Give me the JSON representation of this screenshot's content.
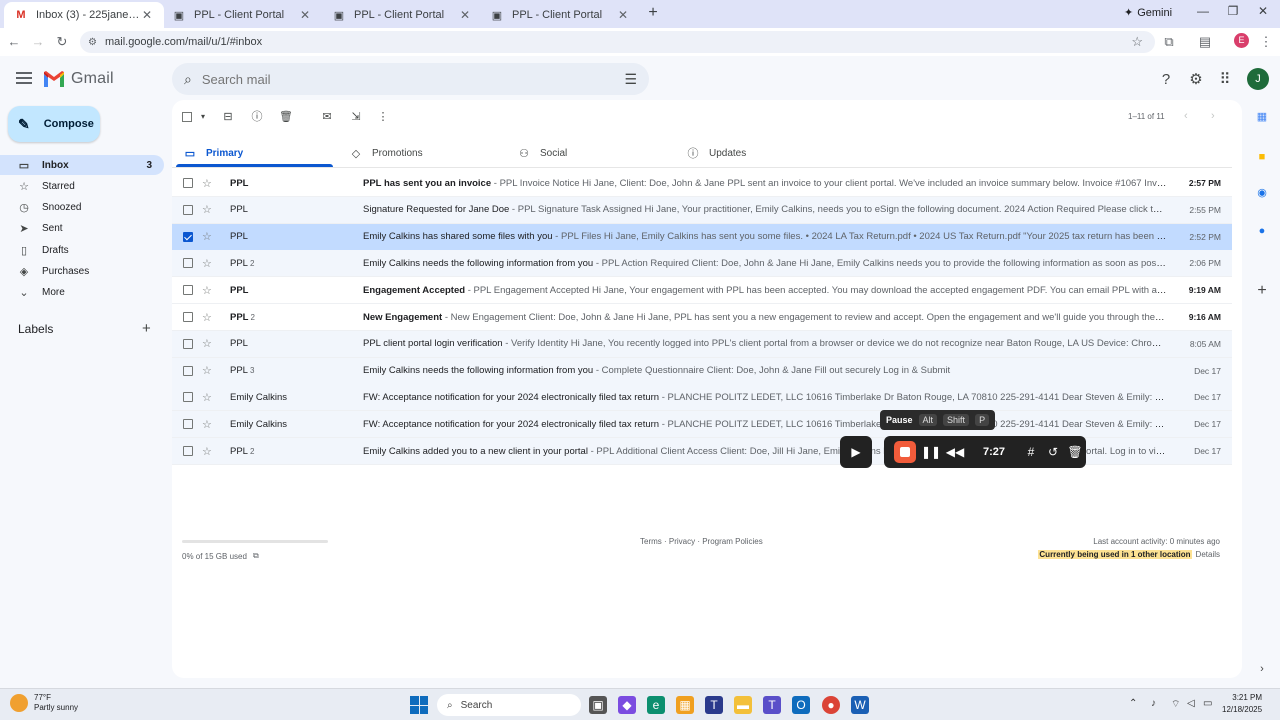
{
  "browser": {
    "tabs": [
      {
        "title": "Inbox (3) - 225janedoe@gmail.com",
        "favicon": "gmail-icon",
        "active": true
      },
      {
        "title": "PPL - Client Portal",
        "favicon": "page-icon",
        "active": false
      },
      {
        "title": "PPL - Client Portal",
        "favicon": "page-icon",
        "active": false
      },
      {
        "title": "PPL - Client Portal",
        "favicon": "page-icon",
        "active": false
      }
    ],
    "gemini_label": "Gemini",
    "url": "mail.google.com/mail/u/1/#inbox",
    "profile_initial": "E"
  },
  "gmail": {
    "logo_text": "Gmail",
    "search_placeholder": "Search mail",
    "avatar_initial": "J",
    "compose_label": "Compose",
    "nav": [
      {
        "label": "Inbox",
        "count": "3",
        "icon": "inbox-icon",
        "glyph": "▭",
        "active": true
      },
      {
        "label": "Starred",
        "count": "",
        "icon": "star-icon",
        "glyph": "☆",
        "active": false
      },
      {
        "label": "Snoozed",
        "count": "",
        "icon": "clock-icon",
        "glyph": "◷",
        "active": false
      },
      {
        "label": "Sent",
        "count": "",
        "icon": "send-icon",
        "glyph": "➤",
        "active": false
      },
      {
        "label": "Drafts",
        "count": "",
        "icon": "draft-icon",
        "glyph": "▯",
        "active": false
      },
      {
        "label": "Purchases",
        "count": "",
        "icon": "tag-icon",
        "glyph": "◈",
        "active": false
      },
      {
        "label": "More",
        "count": "",
        "icon": "chevron-down-icon",
        "glyph": "⌄",
        "active": false
      }
    ],
    "labels_heading": "Labels",
    "pager_text": "1–11 of 11",
    "categories": [
      {
        "label": "Primary",
        "icon": "inbox-icon",
        "glyph": "▭",
        "active": true
      },
      {
        "label": "Promotions",
        "icon": "tag-icon",
        "glyph": "◇",
        "active": false
      },
      {
        "label": "Social",
        "icon": "people-icon",
        "glyph": "⚇",
        "active": false
      },
      {
        "label": "Updates",
        "icon": "info-icon",
        "glyph": "ⓘ",
        "active": false
      }
    ],
    "emails": [
      {
        "sender": "PPL",
        "count": "",
        "subject": "PPL has sent you an invoice",
        "preview": " - PPL Invoice Notice Hi Jane, Client: Doe, John & Jane PPL sent an invoice to your client portal. We've included an invoice summary below. Invoice #1067 Invoic...",
        "date": "2:57 PM",
        "unread": true,
        "selected": false
      },
      {
        "sender": "PPL",
        "count": "",
        "subject": "Signature Requested for Jane Doe",
        "preview": " - PPL Signature Task Assigned Hi Jane, Your practitioner, Emily Calkins, needs you to eSign the following document. 2024 Action Required Please click the...",
        "date": "2:55 PM",
        "unread": false,
        "selected": false
      },
      {
        "sender": "PPL",
        "count": "",
        "subject": "Emily Calkins has shared some files with you",
        "preview": " - PPL Files Hi Jane, Emily Calkins has sent you some files. • 2024 LA Tax Return.pdf • 2024 US Tax Return.pdf \"Your 2025 tax return has been po...",
        "date": "2:52 PM",
        "unread": false,
        "selected": true
      },
      {
        "sender": "PPL",
        "count": "2",
        "subject": "Emily Calkins needs the following information from you",
        "preview": " - PPL Action Required Client: Doe, John & Jane Hi Jane, Emily Calkins needs you to provide the following information as soon as possi...",
        "date": "2:06 PM",
        "unread": false,
        "selected": false
      },
      {
        "sender": "PPL",
        "count": "",
        "subject": "Engagement Accepted",
        "preview": " - PPL Engagement Accepted Hi Jane, Your engagement with PPL has been accepted. You may download the accepted engagement PDF. You can email PPL with an...",
        "date": "9:19 AM",
        "unread": true,
        "selected": false
      },
      {
        "sender": "PPL",
        "count": "2",
        "subject": "New Engagement",
        "preview": " - New Engagement Client: Doe, John & Jane Hi Jane, PPL has sent you a new engagement to review and accept. Open the engagement and we'll guide you through the e...",
        "date": "9:16 AM",
        "unread": true,
        "selected": false
      },
      {
        "sender": "PPL",
        "count": "",
        "subject": "PPL client portal login verification",
        "preview": " - Verify Identity Hi Jane, You recently logged into PPL's client portal from a browser or device we do not recognize near Baton Rouge, LA US Device: Chrom...",
        "date": "8:05 AM",
        "unread": false,
        "selected": false
      },
      {
        "sender": "PPL",
        "count": "3",
        "subject": "Emily Calkins needs the following information from you",
        "preview": " - Complete Questionnaire Client: Doe, John & Jane Fill out securely Log in & Submit",
        "date": "Dec 17",
        "unread": false,
        "selected": false
      },
      {
        "sender": "Emily Calkins",
        "count": "",
        "subject": "FW: Acceptance notification for your 2024 electronically filed tax return",
        "preview": " - PLANCHE POLITZ LEDET, LLC 10616 Timberlake Dr Baton Rouge, LA 70810 225-291-4141 Dear Steven & Emily: Your ...",
        "date": "Dec 17",
        "unread": false,
        "selected": false
      },
      {
        "sender": "Emily Calkins",
        "count": "",
        "subject": "FW: Acceptance notification for your 2024 electronically filed tax return",
        "preview": " - PLANCHE POLITZ LEDET, LLC 10616 Timberlake Dr Baton Rouge, LA 70810 225-291-4141 Dear Steven & Emily: Your ...",
        "date": "Dec 17",
        "unread": false,
        "selected": false
      },
      {
        "sender": "PPL",
        "count": "2",
        "subject": "Emily Calkins added you to a new client in your portal",
        "preview": " - PPL Additional Client Access Client: Doe, Jill Hi Jane, Emily Calkins has granted you access to a new client in your portal. Log in to view Doe...",
        "date": "Dec 17",
        "unread": false,
        "selected": false
      }
    ],
    "footer": {
      "storage": "0% of 15 GB used",
      "storage_used_fraction": 0,
      "links": "Terms · Privacy · Program Policies",
      "activity": "Last account activity: 0 minutes ago",
      "other_location": "Currently being used in 1 other location",
      "details": "Details"
    }
  },
  "recorder": {
    "time": "7:27",
    "tooltip": {
      "label": "Pause",
      "keys": [
        "Alt",
        "Shift",
        "P"
      ]
    }
  },
  "taskbar": {
    "weather_temp": "77°F",
    "weather_desc": "Partly sunny",
    "search_label": "Search",
    "time": "3:21 PM",
    "date": "12/18/2025"
  },
  "colors": {
    "accent": "#0b57d0",
    "compose_bg": "#c2e7ff",
    "selected_row": "#c2dbff",
    "record_red": "#f25c3b"
  }
}
